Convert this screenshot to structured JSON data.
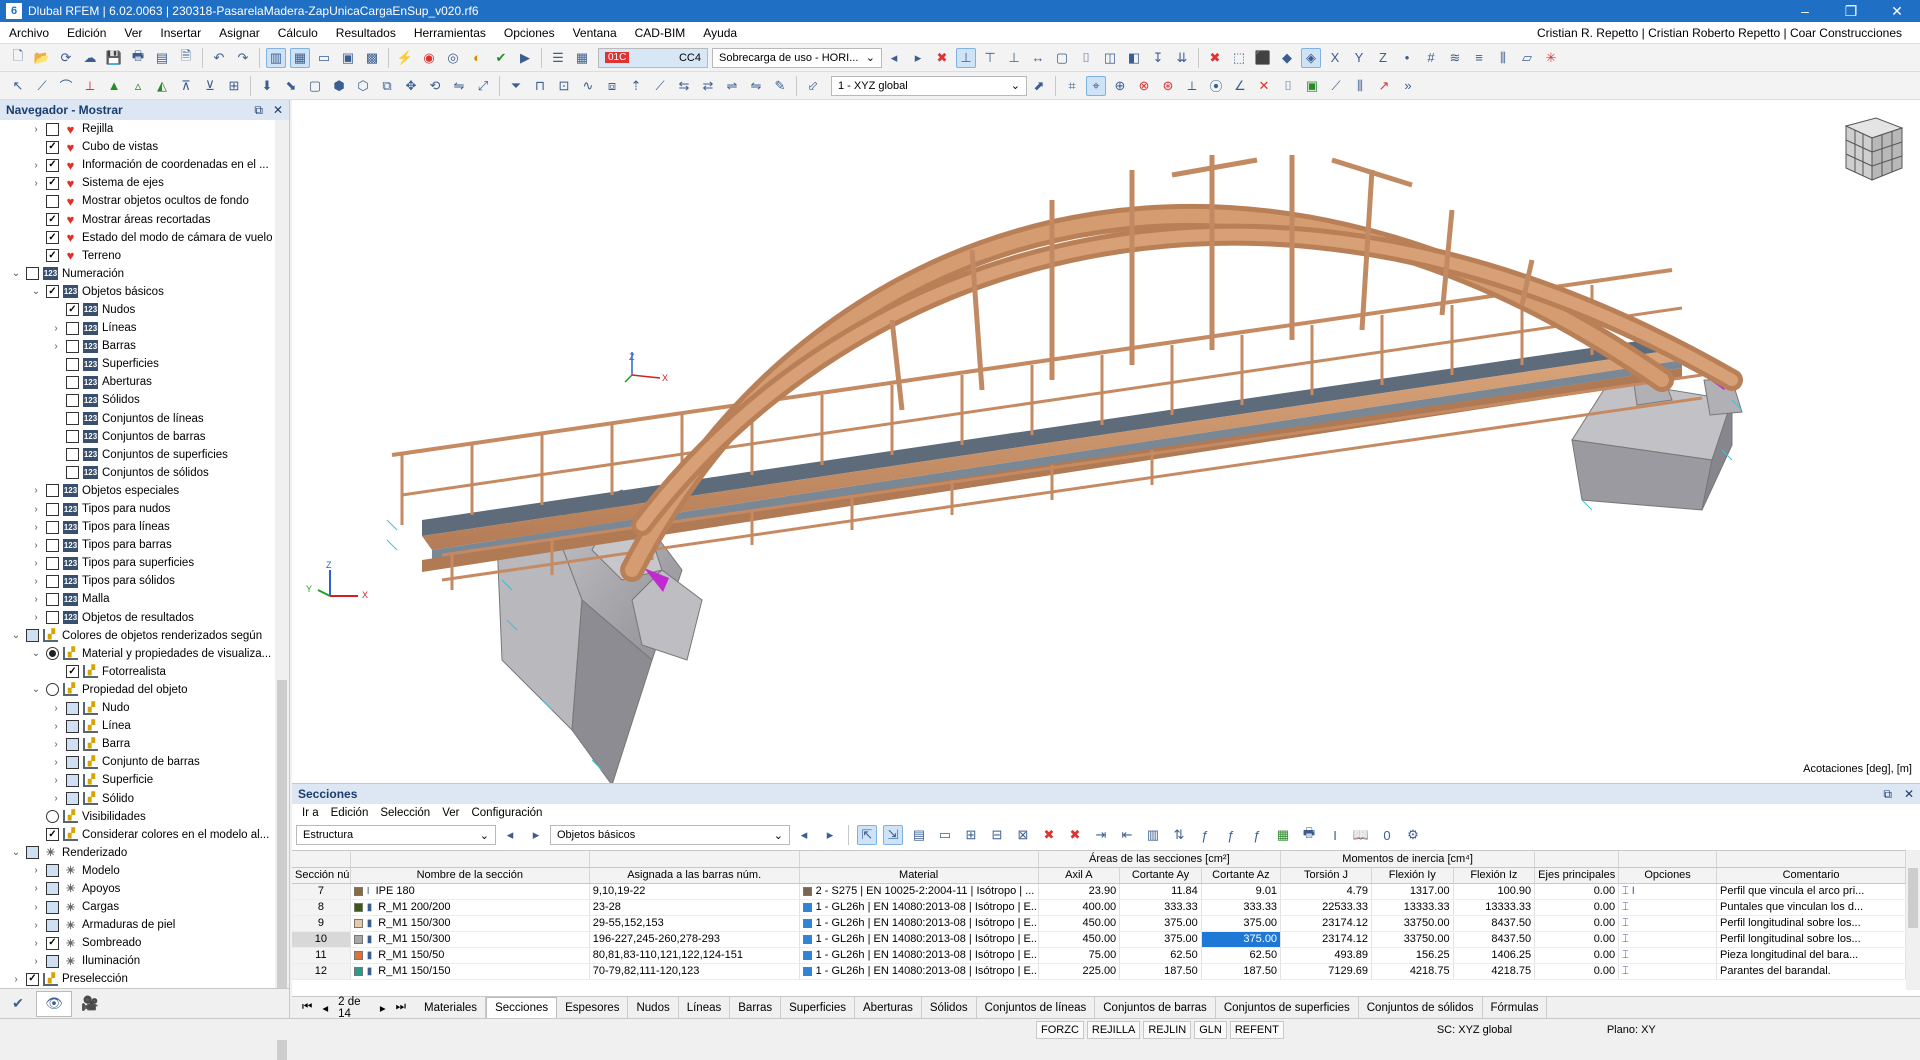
{
  "app": {
    "title": "Dlubal RFEM | 6.02.0063 | 230318-PasarelaMadera-ZapUnicaCargaEnSup_v020.rf6",
    "icon_text": "6"
  },
  "menu": [
    "Archivo",
    "Edición",
    "Ver",
    "Insertar",
    "Asignar",
    "Cálculo",
    "Resultados",
    "Herramientas",
    "Opciones",
    "Ventana",
    "CAD-BIM",
    "Ayuda"
  ],
  "user": "Cristian R. Repetto | Cristian Roberto Repetto | Coar Construcciones",
  "toolbar": {
    "lc_badge": "01C",
    "lc_code": "CC4",
    "lc_name": "Sobrecarga de uso - HORI...",
    "view_combo": "1 - XYZ global"
  },
  "navigator": {
    "title": "Navegador - Mostrar",
    "items": [
      {
        "ind": 1,
        "exp": "›",
        "box": "chk",
        "val": "off",
        "icon": "heart",
        "label": "Rejilla"
      },
      {
        "ind": 1,
        "exp": "",
        "box": "chk",
        "val": "on",
        "icon": "heart",
        "label": "Cubo de vistas"
      },
      {
        "ind": 1,
        "exp": "›",
        "box": "chk",
        "val": "on",
        "icon": "heart",
        "label": "Información de coordenadas en el ..."
      },
      {
        "ind": 1,
        "exp": "›",
        "box": "chk",
        "val": "on",
        "icon": "heart",
        "label": "Sistema de ejes"
      },
      {
        "ind": 1,
        "exp": "",
        "box": "chk",
        "val": "off",
        "icon": "heart",
        "label": "Mostrar objetos ocultos de fondo"
      },
      {
        "ind": 1,
        "exp": "",
        "box": "chk",
        "val": "on",
        "icon": "heart",
        "label": "Mostrar áreas recortadas"
      },
      {
        "ind": 1,
        "exp": "",
        "box": "chk",
        "val": "on",
        "icon": "heart",
        "label": "Estado del modo de cámara de vuelo"
      },
      {
        "ind": 1,
        "exp": "",
        "box": "chk",
        "val": "on",
        "icon": "heart",
        "label": "Terreno"
      },
      {
        "ind": 0,
        "exp": "⌄",
        "box": "chk",
        "val": "off",
        "icon": "num",
        "label": "Numeración"
      },
      {
        "ind": 1,
        "exp": "⌄",
        "box": "chk",
        "val": "on",
        "icon": "num",
        "label": "Objetos básicos"
      },
      {
        "ind": 2,
        "exp": "",
        "box": "chk",
        "val": "on",
        "icon": "num",
        "label": "Nudos"
      },
      {
        "ind": 2,
        "exp": "›",
        "box": "chk",
        "val": "off",
        "icon": "num",
        "label": "Líneas"
      },
      {
        "ind": 2,
        "exp": "›",
        "box": "chk",
        "val": "off",
        "icon": "num",
        "label": "Barras"
      },
      {
        "ind": 2,
        "exp": "",
        "box": "chk",
        "val": "off",
        "icon": "num",
        "label": "Superficies"
      },
      {
        "ind": 2,
        "exp": "",
        "box": "chk",
        "val": "off",
        "icon": "num",
        "label": "Aberturas"
      },
      {
        "ind": 2,
        "exp": "",
        "box": "chk",
        "val": "off",
        "icon": "num",
        "label": "Sólidos"
      },
      {
        "ind": 2,
        "exp": "",
        "box": "chk",
        "val": "off",
        "icon": "num",
        "label": "Conjuntos de líneas"
      },
      {
        "ind": 2,
        "exp": "",
        "box": "chk",
        "val": "off",
        "icon": "num",
        "label": "Conjuntos de barras"
      },
      {
        "ind": 2,
        "exp": "",
        "box": "chk",
        "val": "off",
        "icon": "num",
        "label": "Conjuntos de superficies"
      },
      {
        "ind": 2,
        "exp": "",
        "box": "chk",
        "val": "off",
        "icon": "num",
        "label": "Conjuntos de sólidos"
      },
      {
        "ind": 1,
        "exp": "›",
        "box": "chk",
        "val": "off",
        "icon": "num",
        "label": "Objetos especiales"
      },
      {
        "ind": 1,
        "exp": "›",
        "box": "chk",
        "val": "off",
        "icon": "num",
        "label": "Tipos para nudos"
      },
      {
        "ind": 1,
        "exp": "›",
        "box": "chk",
        "val": "off",
        "icon": "num",
        "label": "Tipos para líneas"
      },
      {
        "ind": 1,
        "exp": "›",
        "box": "chk",
        "val": "off",
        "icon": "num",
        "label": "Tipos para barras"
      },
      {
        "ind": 1,
        "exp": "›",
        "box": "chk",
        "val": "off",
        "icon": "num",
        "label": "Tipos para superficies"
      },
      {
        "ind": 1,
        "exp": "›",
        "box": "chk",
        "val": "off",
        "icon": "num",
        "label": "Tipos para sólidos"
      },
      {
        "ind": 1,
        "exp": "›",
        "box": "chk",
        "val": "off",
        "icon": "num",
        "label": "Malla"
      },
      {
        "ind": 1,
        "exp": "›",
        "box": "chk",
        "val": "off",
        "icon": "num",
        "label": "Objetos de resultados"
      },
      {
        "ind": 0,
        "exp": "⌄",
        "box": "chk",
        "val": "part",
        "icon": "chart",
        "label": "Colores de objetos renderizados según"
      },
      {
        "ind": 1,
        "exp": "⌄",
        "box": "rad",
        "val": "on",
        "icon": "chart",
        "label": "Material y propiedades de visualiza..."
      },
      {
        "ind": 2,
        "exp": "",
        "box": "chk",
        "val": "on",
        "icon": "chart",
        "label": "Fotorrealista"
      },
      {
        "ind": 1,
        "exp": "⌄",
        "box": "rad",
        "val": "off",
        "icon": "chart",
        "label": "Propiedad del objeto"
      },
      {
        "ind": 2,
        "exp": "›",
        "box": "chk",
        "val": "part",
        "icon": "chart",
        "label": "Nudo"
      },
      {
        "ind": 2,
        "exp": "›",
        "box": "chk",
        "val": "part",
        "icon": "chart",
        "label": "Línea"
      },
      {
        "ind": 2,
        "exp": "›",
        "box": "chk",
        "val": "part",
        "icon": "chart",
        "label": "Barra"
      },
      {
        "ind": 2,
        "exp": "›",
        "box": "chk",
        "val": "part",
        "icon": "chart",
        "label": "Conjunto de barras"
      },
      {
        "ind": 2,
        "exp": "›",
        "box": "chk",
        "val": "part",
        "icon": "chart",
        "label": "Superficie"
      },
      {
        "ind": 2,
        "exp": "›",
        "box": "chk",
        "val": "part",
        "icon": "chart",
        "label": "Sólido"
      },
      {
        "ind": 1,
        "exp": "",
        "box": "rad",
        "val": "off",
        "icon": "chart",
        "label": "Visibilidades"
      },
      {
        "ind": 1,
        "exp": "",
        "box": "chk",
        "val": "on",
        "icon": "chart",
        "label": "Considerar colores en el modelo al..."
      },
      {
        "ind": 0,
        "exp": "⌄",
        "box": "chk",
        "val": "part",
        "icon": "lamp",
        "label": "Renderizado"
      },
      {
        "ind": 1,
        "exp": "›",
        "box": "chk",
        "val": "part",
        "icon": "lamp",
        "label": "Modelo"
      },
      {
        "ind": 1,
        "exp": "›",
        "box": "chk",
        "val": "part",
        "icon": "lamp",
        "label": "Apoyos"
      },
      {
        "ind": 1,
        "exp": "›",
        "box": "chk",
        "val": "part",
        "icon": "lamp",
        "label": "Cargas"
      },
      {
        "ind": 1,
        "exp": "›",
        "box": "chk",
        "val": "part",
        "icon": "lamp",
        "label": "Armaduras de piel"
      },
      {
        "ind": 1,
        "exp": "›",
        "box": "chk",
        "val": "on",
        "icon": "lamp",
        "label": "Sombreado"
      },
      {
        "ind": 1,
        "exp": "›",
        "box": "chk",
        "val": "part",
        "icon": "lamp",
        "label": "Iluminación"
      },
      {
        "ind": 0,
        "exp": "›",
        "box": "chk",
        "val": "on",
        "icon": "chart",
        "label": "Preselección"
      }
    ]
  },
  "viewport": {
    "units_label": "Acotaciones [deg], [m]",
    "axis_x": "X",
    "axis_y": "Y",
    "axis_z": "Z"
  },
  "sections_panel": {
    "title": "Secciones",
    "menu": [
      "Ir a",
      "Edición",
      "Selección",
      "Ver",
      "Configuración"
    ],
    "combo_structure": "Estructura",
    "combo_objects": "Objetos básicos",
    "group_headers": {
      "areas": "Áreas de las secciones [cm²]",
      "inertia": "Momentos de inercia [cm⁴]"
    },
    "columns": [
      "Sección núm.",
      "Nombre de la sección",
      "Asignada a las barras núm.",
      "Material",
      "Axil A",
      "Cortante Ay",
      "Cortante Az",
      "Torsión J",
      "Flexión Iy",
      "Flexión Iz",
      "Ejes principales α [deg]",
      "Opciones",
      "Comentario"
    ],
    "rows": [
      {
        "no": "7",
        "color": "#8b6a3e",
        "icon": "I",
        "name": "IPE 180",
        "bars": "9,10,19-22",
        "mat_color": "#7a6650",
        "mat": "2 - S275 | EN 10025-2:2004-11 | Isótropo | ...",
        "a": "23.90",
        "ay": "11.84",
        "az": "9.01",
        "j": "4.79",
        "iy": "1317.00",
        "iz": "100.90",
        "alpha": "0.00",
        "opt": "I",
        "comment": "Perfil que vincula el arco pri..."
      },
      {
        "no": "8",
        "color": "#3a5a16",
        "icon": "▮",
        "name": "R_M1 200/200",
        "bars": "23-28",
        "mat_color": "#2f84d4",
        "mat": "1 - GL26h | EN 14080:2013-08 | Isótropo | E...",
        "a": "400.00",
        "ay": "333.33",
        "az": "333.33",
        "j": "22533.33",
        "iy": "13333.33",
        "iz": "13333.33",
        "alpha": "0.00",
        "opt": "",
        "comment": "Puntales que vinculan los d..."
      },
      {
        "no": "9",
        "color": "#e5c9a8",
        "icon": "▮",
        "name": "R_M1 150/300",
        "bars": "29-55,152,153",
        "mat_color": "#2f84d4",
        "mat": "1 - GL26h | EN 14080:2013-08 | Isótropo | E...",
        "a": "450.00",
        "ay": "375.00",
        "az": "375.00",
        "j": "23174.12",
        "iy": "33750.00",
        "iz": "8437.50",
        "alpha": "0.00",
        "opt": "",
        "comment": "Perfil longitudinal sobre los..."
      },
      {
        "no": "10",
        "color": "#a8a8a8",
        "icon": "▮",
        "name": "R_M1 150/300",
        "bars": "196-227,245-260,278-293",
        "mat_color": "#2f84d4",
        "mat": "1 - GL26h | EN 14080:2013-08 | Isótropo | E...",
        "a": "450.00",
        "ay": "375.00",
        "az": "375.00",
        "j": "23174.12",
        "iy": "33750.00",
        "iz": "8437.50",
        "alpha": "0.00",
        "opt": "",
        "comment": "Perfil longitudinal sobre los..."
      },
      {
        "no": "11",
        "color": "#e0703a",
        "icon": "▮",
        "name": "R_M1 150/50",
        "bars": "80,81,83-110,121,122,124-151",
        "mat_color": "#2f84d4",
        "mat": "1 - GL26h | EN 14080:2013-08 | Isótropo | E...",
        "a": "75.00",
        "ay": "62.50",
        "az": "62.50",
        "j": "493.89",
        "iy": "156.25",
        "iz": "1406.25",
        "alpha": "0.00",
        "opt": "",
        "comment": "Pieza longitudinal del bara..."
      },
      {
        "no": "12",
        "color": "#2a9a8a",
        "icon": "▮",
        "name": "R_M1 150/150",
        "bars": "70-79,82,111-120,123",
        "mat_color": "#2f84d4",
        "mat": "1 - GL26h | EN 14080:2013-08 | Isótropo | E...",
        "a": "225.00",
        "ay": "187.50",
        "az": "187.50",
        "j": "7129.69",
        "iy": "4218.75",
        "iz": "4218.75",
        "alpha": "0.00",
        "opt": "",
        "comment": "Parantes del barandal."
      }
    ],
    "pager": "2 de 14",
    "tabs": [
      "Materiales",
      "Secciones",
      "Espesores",
      "Nudos",
      "Líneas",
      "Barras",
      "Superficies",
      "Aberturas",
      "Sólidos",
      "Conjuntos de líneas",
      "Conjuntos de barras",
      "Conjuntos de superficies",
      "Conjuntos de sólidos",
      "Fórmulas"
    ]
  },
  "statusbar": {
    "toggles": [
      "FORZC",
      "REJILLA",
      "REJLIN",
      "GLN",
      "REFENT"
    ],
    "cs": "SC: XYZ global",
    "plane": "Plano: XY"
  }
}
